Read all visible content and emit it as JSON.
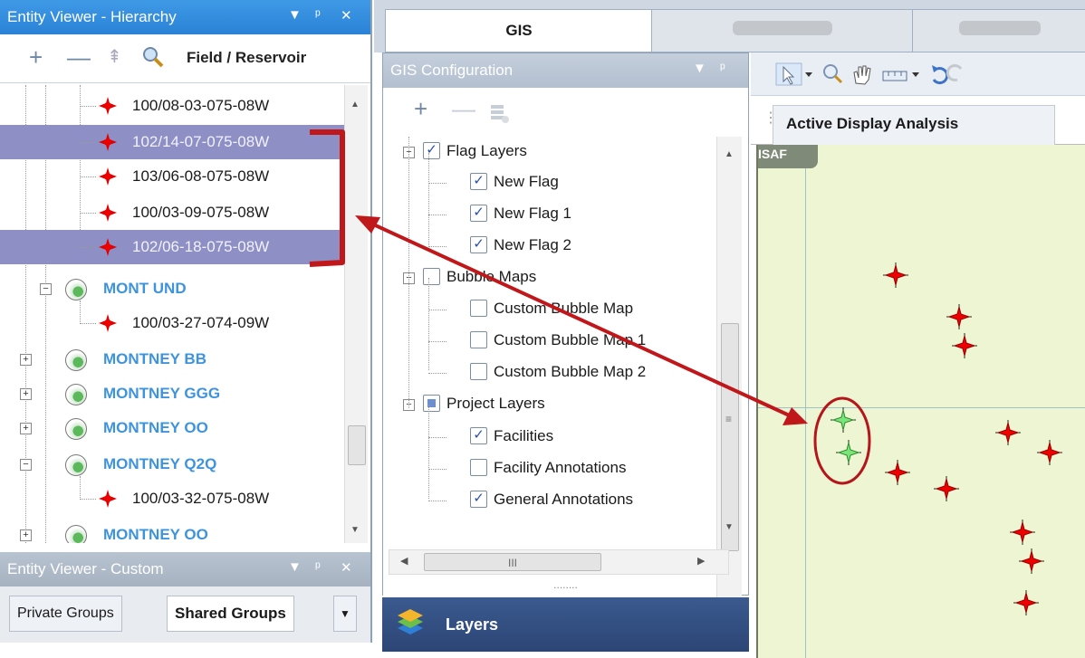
{
  "entity_viewer": {
    "title": "Entity Viewer - Hierarchy",
    "controls": [
      "▼",
      "ᵖ",
      "✕"
    ],
    "toolbar": {
      "add": "+",
      "remove": "—",
      "up": "⇞",
      "search": "search-icon",
      "field_label": "Field / Reservoir"
    },
    "tree": [
      {
        "type": "well",
        "label": "100/08-03-075-08W",
        "selected": false
      },
      {
        "type": "well",
        "label": "102/14-07-075-08W",
        "selected": true
      },
      {
        "type": "well",
        "label": "103/06-08-075-08W",
        "selected": false
      },
      {
        "type": "well",
        "label": "100/03-09-075-08W",
        "selected": false
      },
      {
        "type": "well",
        "label": "102/06-18-075-08W",
        "selected": true
      },
      {
        "type": "group",
        "label": "MONT UND",
        "expanded": true
      },
      {
        "type": "well",
        "label": "100/03-27-074-09W",
        "selected": false
      },
      {
        "type": "group",
        "label": "MONTNEY BB",
        "expanded": false
      },
      {
        "type": "group",
        "label": "MONTNEY GGG",
        "expanded": false
      },
      {
        "type": "group",
        "label": "MONTNEY OO",
        "expanded": false
      },
      {
        "type": "group",
        "label": "MONTNEY Q2Q",
        "expanded": true
      },
      {
        "type": "well",
        "label": "100/03-32-075-08W",
        "selected": false
      },
      {
        "type": "group",
        "label": "MONTNEY OO",
        "expanded": false
      }
    ]
  },
  "custom_viewer": {
    "title": "Entity Viewer - Custom",
    "tabs": [
      "Private Groups",
      "Shared Groups"
    ],
    "active_tab": "Shared Groups",
    "dropdown": "▼"
  },
  "top_tabs": [
    "GIS",
    "",
    ""
  ],
  "gis_config": {
    "title": "GIS Configuration",
    "controls": [
      "▼",
      "ᵖ"
    ],
    "toolbar": {
      "add": "+",
      "remove": "—"
    },
    "layers": [
      {
        "label": "Flag Layers",
        "level": 0,
        "state": "checked"
      },
      {
        "label": "New Flag",
        "level": 1,
        "state": "checked"
      },
      {
        "label": "New Flag 1",
        "level": 1,
        "state": "checked"
      },
      {
        "label": "New Flag 2",
        "level": 1,
        "state": "checked"
      },
      {
        "label": "Bubble Maps",
        "level": 0,
        "state": "unchecked"
      },
      {
        "label": "Custom Bubble Map",
        "level": 1,
        "state": "unchecked"
      },
      {
        "label": "Custom Bubble Map 1",
        "level": 1,
        "state": "unchecked"
      },
      {
        "label": "Custom Bubble Map 2",
        "level": 1,
        "state": "unchecked"
      },
      {
        "label": "Project Layers",
        "level": 0,
        "state": "partial"
      },
      {
        "label": "Facilities",
        "level": 1,
        "state": "checked"
      },
      {
        "label": "Facility Annotations",
        "level": 1,
        "state": "unchecked"
      },
      {
        "label": "General Annotations",
        "level": 1,
        "state": "checked"
      }
    ],
    "hscroll_grip": "III",
    "splitter": "........"
  },
  "layers_bar": {
    "label": "Layers"
  },
  "map_panel": {
    "tab_label": "Active Display Analysis",
    "corner_label": "ISAF"
  },
  "colors": {
    "selected_row": "#8e8fc4",
    "group_text": "#3e94dc",
    "map_bg": "#eef5d2",
    "red_annotation": "#c0171b",
    "titlebar_active": "#2a82d6"
  }
}
